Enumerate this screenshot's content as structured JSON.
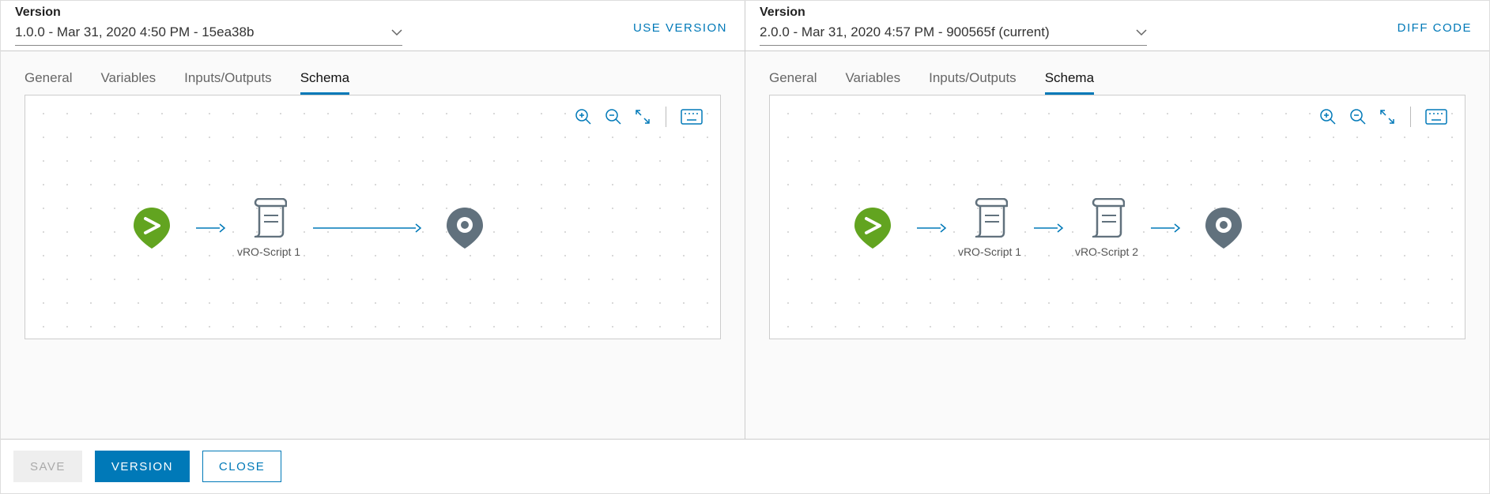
{
  "left": {
    "label": "Version",
    "version_text": "1.0.0 - Mar 31, 2020 4:50 PM - 15ea38b",
    "action": "USE VERSION",
    "tabs": [
      "General",
      "Variables",
      "Inputs/Outputs",
      "Schema"
    ],
    "active_tab": "Schema",
    "nodes": [
      {
        "type": "start"
      },
      {
        "type": "script",
        "label": "vRO-Script 1"
      },
      {
        "type": "end"
      }
    ]
  },
  "right": {
    "label": "Version",
    "version_text": "2.0.0 - Mar 31, 2020 4:57 PM - 900565f (current)",
    "action": "DIFF CODE",
    "tabs": [
      "General",
      "Variables",
      "Inputs/Outputs",
      "Schema"
    ],
    "active_tab": "Schema",
    "nodes": [
      {
        "type": "start"
      },
      {
        "type": "script",
        "label": "vRO-Script 1"
      },
      {
        "type": "script",
        "label": "vRO-Script 2"
      },
      {
        "type": "end"
      }
    ]
  },
  "footer": {
    "save": "SAVE",
    "version": "VERSION",
    "close": "CLOSE"
  },
  "toolbar_icons": [
    "zoom-in",
    "zoom-out",
    "fit",
    "keyboard"
  ]
}
